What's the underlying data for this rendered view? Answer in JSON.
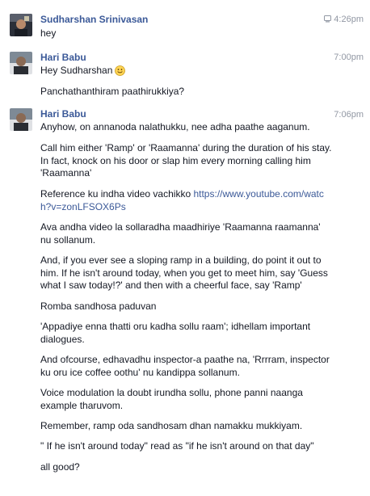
{
  "colors": {
    "sender": "#3b5998",
    "text": "#141823",
    "timestamp": "#9197a3",
    "link": "#3b5998"
  },
  "conversation": [
    {
      "sender": "Sudharshan Srinivasan",
      "time": "4:26pm",
      "time_icon": "mobile-device-icon",
      "messages": [
        "hey"
      ]
    },
    {
      "sender": "Hari Babu",
      "time": "7:00pm",
      "messages": [
        "Hey Sudharshan",
        "Panchathanthiram paathirukkiya?"
      ],
      "emoji": "smiley-emoji-icon"
    },
    {
      "sender": "Hari Babu",
      "time": "7:06pm",
      "messages": [
        "Anyhow, on annanoda nalathukku, nee adha paathe aaganum.",
        "Call him either 'Ramp' or 'Raamanna' during the duration of his stay. In fact, knock on his door or slap him every morning calling him 'Raamanna'",
        "Reference ku indha video vachikko",
        "Ava andha video la sollaradha maadhiriye 'Raamanna raamanna' nu sollanum.",
        "And, if you ever see a sloping ramp in a building, do point it out to him. If he isn't around today, when you get to meet him, say 'Guess what I saw today!?' and then with a cheerful face, say 'Ramp'",
        "Romba sandhosa paduvan",
        "'Appadiye enna thatti oru kadha sollu raam'; idhellam important dialogues.",
        "And ofcourse, edhavadhu inspector-a paathe na, 'Rrrram, inspector ku oru ice coffee oothu' nu kandippa sollanum.",
        "Voice modulation la doubt irundha sollu, phone panni naanga example tharuvom.",
        "Remember, ramp oda sandhosam dhan namakku mukkiyam.",
        "\" If he isn't around today\" read as \"if he isn't around on that day\"",
        "all good?"
      ],
      "link": "https://www.youtube.com/watch?v=zonLFSOX6Ps"
    }
  ]
}
